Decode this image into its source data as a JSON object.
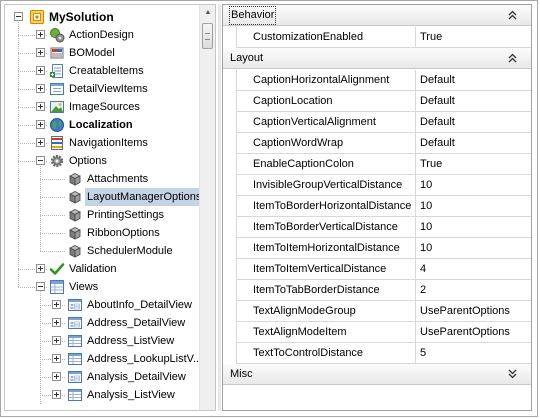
{
  "tree": {
    "items": [
      {
        "label": "MySolution",
        "icon": "solution-icon",
        "level": 0,
        "expander": "minus",
        "style": "root"
      },
      {
        "label": "ActionDesign",
        "icon": "action-design-icon",
        "level": 1,
        "expander": "plus"
      },
      {
        "label": "BOModel",
        "icon": "bo-model-icon",
        "level": 1,
        "expander": "plus"
      },
      {
        "label": "CreatableItems",
        "icon": "creatable-items-icon",
        "level": 1,
        "expander": "plus"
      },
      {
        "label": "DetailViewItems",
        "icon": "detail-view-items-icon",
        "level": 1,
        "expander": "plus"
      },
      {
        "label": "ImageSources",
        "icon": "image-sources-icon",
        "level": 1,
        "expander": "plus"
      },
      {
        "label": "Localization",
        "icon": "globe-icon",
        "level": 1,
        "expander": "plus",
        "style": "bold"
      },
      {
        "label": "NavigationItems",
        "icon": "navigation-items-icon",
        "level": 1,
        "expander": "plus"
      },
      {
        "label": "Options",
        "icon": "options-gear-icon",
        "level": 1,
        "expander": "minus"
      },
      {
        "label": "Attachments",
        "icon": "cube-icon",
        "level": 2
      },
      {
        "label": "LayoutManagerOptions",
        "icon": "cube-icon",
        "level": 2,
        "selected": true
      },
      {
        "label": "PrintingSettings",
        "icon": "cube-icon",
        "level": 2
      },
      {
        "label": "RibbonOptions",
        "icon": "cube-icon",
        "level": 2
      },
      {
        "label": "SchedulerModule",
        "icon": "cube-icon",
        "level": 2
      },
      {
        "label": "Validation",
        "icon": "checkmark-icon",
        "level": 1,
        "expander": "plus"
      },
      {
        "label": "Views",
        "icon": "views-icon",
        "level": 1,
        "expander": "minus"
      },
      {
        "label": "AboutInfo_DetailView",
        "icon": "detail-view-icon",
        "level": 2,
        "expander": "plus"
      },
      {
        "label": "Address_DetailView",
        "icon": "detail-view-icon",
        "level": 2,
        "expander": "plus"
      },
      {
        "label": "Address_ListView",
        "icon": "list-view-icon",
        "level": 2,
        "expander": "plus"
      },
      {
        "label": "Address_LookupListV...",
        "icon": "list-view-icon",
        "level": 2,
        "expander": "plus"
      },
      {
        "label": "Analysis_DetailView",
        "icon": "detail-view-icon",
        "level": 2,
        "expander": "plus"
      },
      {
        "label": "Analysis_ListView",
        "icon": "list-view-icon",
        "level": 2,
        "expander": "plus"
      }
    ]
  },
  "grid": {
    "categories": [
      {
        "label": "Behavior",
        "toggle": "«",
        "focused": true,
        "rows": [
          {
            "name": "CustomizationEnabled",
            "value": "True"
          }
        ]
      },
      {
        "label": "Layout",
        "toggle": "«",
        "rows": [
          {
            "name": "CaptionHorizontalAlignment",
            "value": "Default"
          },
          {
            "name": "CaptionLocation",
            "value": "Default"
          },
          {
            "name": "CaptionVerticalAlignment",
            "value": "Default"
          },
          {
            "name": "CaptionWordWrap",
            "value": "Default"
          },
          {
            "name": "EnableCaptionColon",
            "value": "True"
          },
          {
            "name": "InvisibleGroupVerticalDistance",
            "value": "10"
          },
          {
            "name": "ItemToBorderHorizontalDistance",
            "value": "10"
          },
          {
            "name": "ItemToBorderVerticalDistance",
            "value": "10"
          },
          {
            "name": "ItemToItemHorizontalDistance",
            "value": "10"
          },
          {
            "name": "ItemToItemVerticalDistance",
            "value": "4"
          },
          {
            "name": "ItemToTabBorderDistance",
            "value": "2"
          },
          {
            "name": "TextAlignModeGroup",
            "value": "UseParentOptions"
          },
          {
            "name": "TextAlignModeItem",
            "value": "UseParentOptions"
          },
          {
            "name": "TextToControlDistance",
            "value": "5"
          }
        ]
      },
      {
        "label": "Misc",
        "toggle": "»",
        "rows": []
      }
    ]
  },
  "colors": {
    "selection": "#c5d3e6",
    "grid_line": "#d8d8d8",
    "category_bg": "#efefef"
  }
}
